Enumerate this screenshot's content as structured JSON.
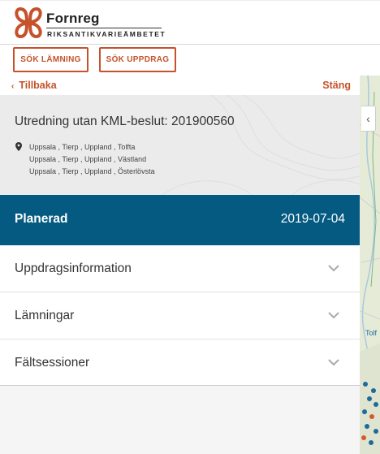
{
  "header": {
    "logo_name": "Fornreg",
    "logo_subtitle": "RIKSANTIKVARIEÄMBETET",
    "logo_icon": "fornreg-logo-icon",
    "brand_color": "#c5522a"
  },
  "search_buttons": {
    "search_remains": "SÖK LÄMNING",
    "search_assignment": "SÖK UPPDRAG"
  },
  "panel": {
    "back_label": "Tillbaka",
    "close_label": "Stäng",
    "title": "Utredning utan KML-beslut: 201900560",
    "locations": [
      "Uppsala , Tierp , Uppland , Tolfta",
      "Uppsala , Tierp , Uppland , Västland",
      "Uppsala , Tierp , Uppland , Österlövsta"
    ],
    "status": {
      "label": "Planerad",
      "date": "2019-07-04",
      "color": "#045a80"
    },
    "accordion": [
      {
        "label": "Uppdragsinformation"
      },
      {
        "label": "Lämningar"
      },
      {
        "label": "Fältsessioner"
      }
    ]
  },
  "map": {
    "place_label": "Tolf"
  }
}
